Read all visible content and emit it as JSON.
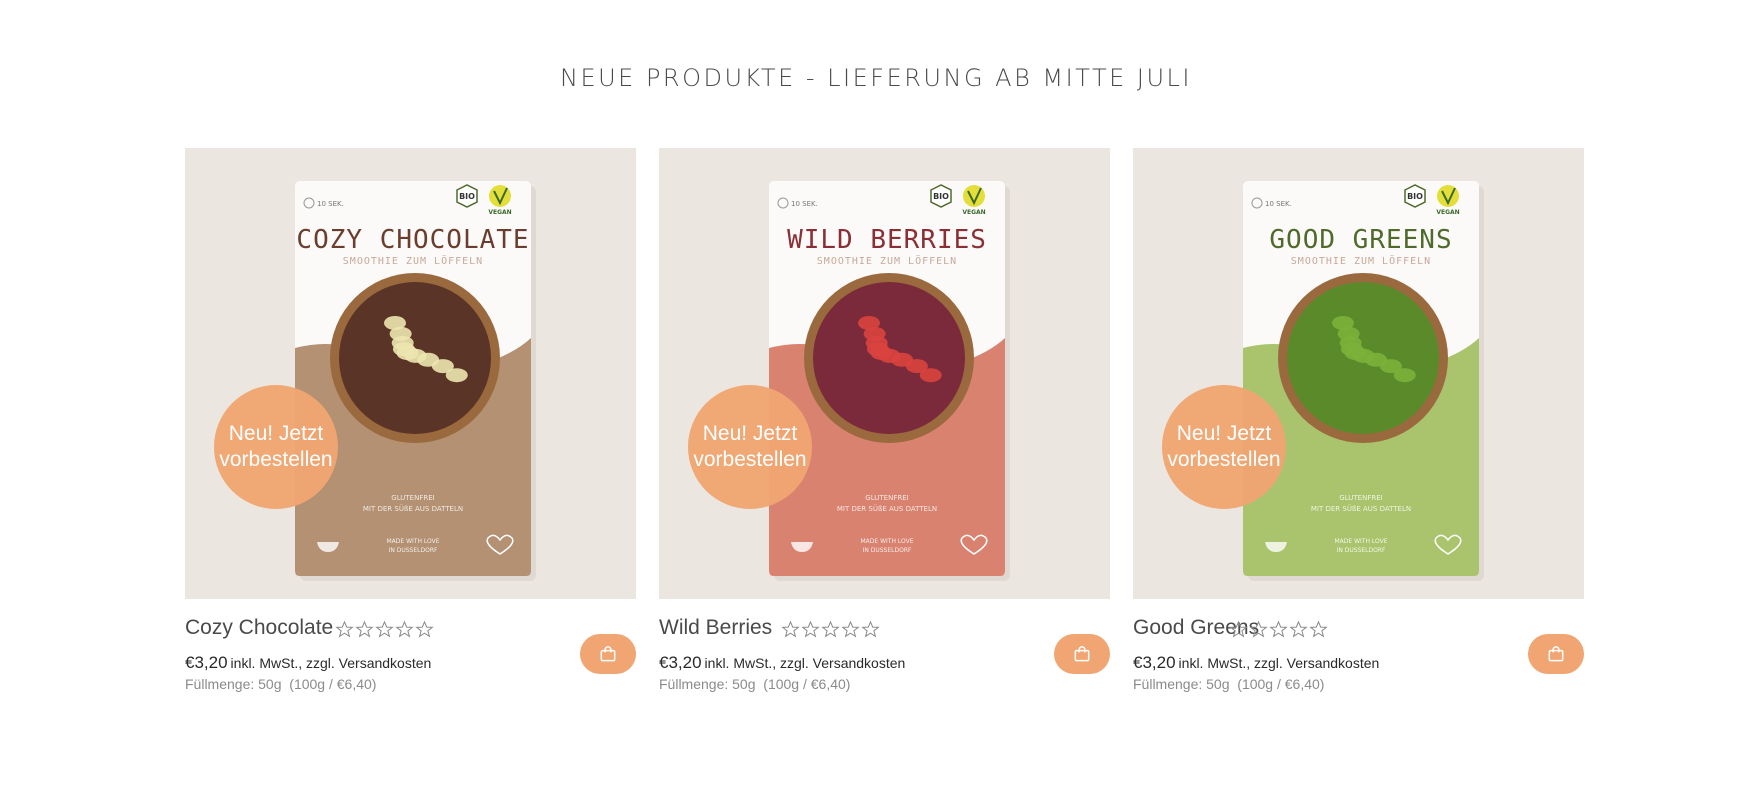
{
  "section": {
    "title": "NEUE PRODUKTE - LIEFERUNG AB MITTE JULI"
  },
  "products": [
    {
      "name": "Cozy Chocolate",
      "price": "€3,20",
      "tax_note": "inkl. MwSt., zzgl. Versandkosten",
      "fill": "Füllmenge: 50g  (100g / €6,40)",
      "rating": 0,
      "badge": [
        "Neu! Jetzt",
        "vorbestellen"
      ],
      "pack_title": "COZY CHOCOLATE",
      "pack_subtitle": "SMOOTHIE ZUM LÖFFELN",
      "pack_footer": [
        "GLUTENFREI",
        "MIT DER SÜßE AUS DATTELN"
      ],
      "pack_made": [
        "MADE WITH LOVE",
        "IN DÜSSELDORF"
      ],
      "pack_time": "10 SEK.",
      "pack_bio": "BIO",
      "pack_vegan": "VEGAN",
      "pack_color": "#b39172",
      "title_color": "#6b3d2e",
      "bowl_color": "#5a3426"
    },
    {
      "name": "Wild Berries",
      "price": "€3,20",
      "tax_note": "inkl. MwSt., zzgl. Versandkosten",
      "fill": "Füllmenge: 50g  (100g / €6,40)",
      "rating": 0,
      "badge": [
        "Neu! Jetzt",
        "vorbestellen"
      ],
      "pack_title": "WILD BERRIES",
      "pack_subtitle": "SMOOTHIE ZUM LÖFFELN",
      "pack_footer": [
        "GLUTENFREI",
        "MIT DER SÜßE AUS DATTELN"
      ],
      "pack_made": [
        "MADE WITH LOVE",
        "IN DÜSSELDORF"
      ],
      "pack_time": "10 SEK.",
      "pack_bio": "BIO",
      "pack_vegan": "VEGAN",
      "pack_color": "#d98270",
      "title_color": "#8a2f35",
      "bowl_color": "#7a2a3a"
    },
    {
      "name": "Good Greens",
      "price": "€3,20",
      "tax_note": "inkl. MwSt., zzgl. Versandkosten",
      "fill": "Füllmenge: 50g  (100g / €6,40)",
      "rating": 0,
      "badge": [
        "Neu! Jetzt",
        "vorbestellen"
      ],
      "pack_title": "GOOD GREENS",
      "pack_subtitle": "SMOOTHIE ZUM LÖFFELN",
      "pack_footer": [
        "GLUTENFREI",
        "MIT DER SÜßE AUS DATTELN"
      ],
      "pack_made": [
        "MADE WITH LOVE",
        "IN DÜSSELDORF"
      ],
      "pack_time": "10 SEK.",
      "pack_bio": "BIO",
      "pack_vegan": "VEGAN",
      "pack_color": "#a9c46c",
      "title_color": "#4f6b2c",
      "bowl_color": "#5a8a2a"
    }
  ],
  "colors": {
    "accent": "#f0a572",
    "tile_bg": "#ece6e0",
    "title": "#4a4a4a",
    "muted": "#8b8b8b"
  },
  "icons": {
    "cart": "shopping-bag-icon",
    "rating": "star-outline-icon"
  }
}
